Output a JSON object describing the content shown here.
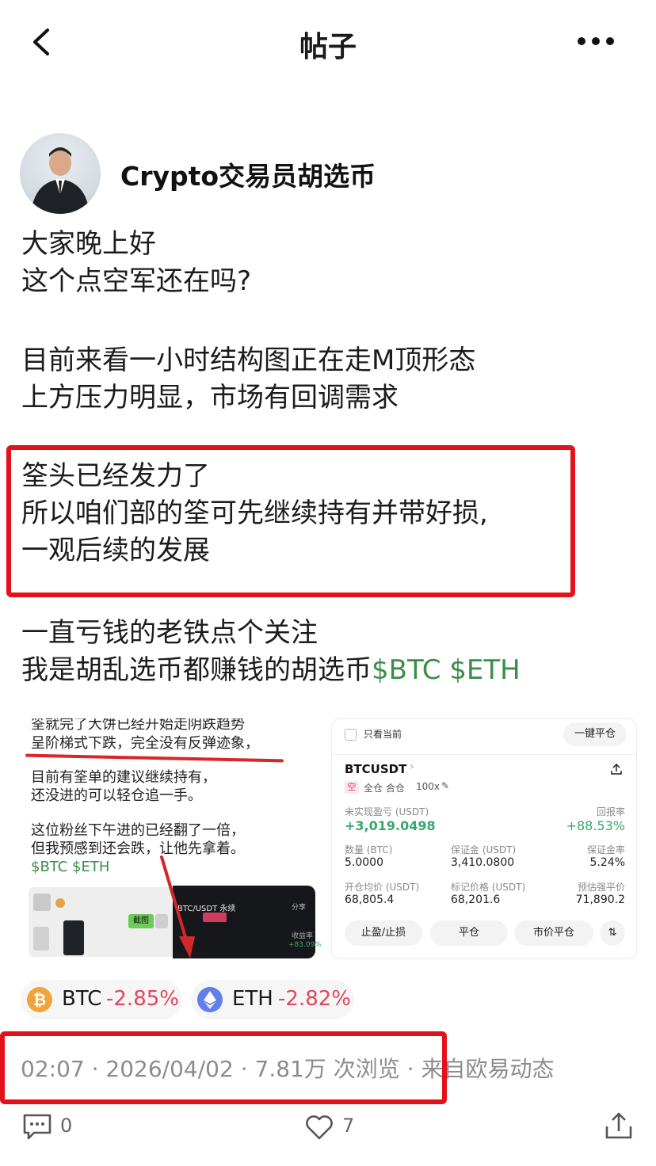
{
  "header": {
    "title": "帖子"
  },
  "author": {
    "name": "Crypto交易员胡选币"
  },
  "post": {
    "lines_1": [
      "大家晚上好",
      "这个点空军还在吗?"
    ],
    "lines_2": [
      "目前来看一小时结构图正在走M顶形态",
      "上方压力明显，市场有回调需求"
    ],
    "lines_3": [
      "筌头已经发力了",
      "所以咱们部的筌可先继续持有并带好损,",
      "一观后续的发展"
    ],
    "lines_4": [
      "一直亏钱的老铁点个关注",
      "我是胡乱选币都赚钱的胡选币"
    ],
    "tag_btc": "$BTC",
    "tag_eth": "$ETH"
  },
  "image_left": {
    "lines": [
      "筌就完了大饼已经开始走阴跌趋势",
      "呈阶梯式下跌，完全没有反弹迹象，",
      "目前有筌单的建议继续持有，",
      "还没进的可以轻仓追一手。",
      "这位粉丝下午进的已经翻了一倍，",
      "但我预感到还会跌，让他先拿着。"
    ],
    "tags": "$BTC $ETH",
    "mini_title": "BTC/USDT 永续",
    "mini_share": "分享",
    "mini_profit": "收益率",
    "mini_pct": "+83.09%",
    "mini_btn": "截图"
  },
  "image_right": {
    "only_current": "只看当前",
    "close_all": "一键平仓",
    "pair": "BTCUSDT",
    "side": "空",
    "mode": "全仓 合仓",
    "leverage": "100x",
    "upnl_label": "未实现盈亏 (USDT)",
    "upnl_value": "+3,019.0498",
    "roe_label": "回报率",
    "roe_value": "+88.53%",
    "qty_label": "数量 (BTC)",
    "qty_value": "5.0000",
    "margin_label": "保证金 (USDT)",
    "margin_value": "3,410.0800",
    "margin_rate_label": "保证金率",
    "margin_rate_value": "5.24%",
    "entry_label": "开仓均价 (USDT)",
    "entry_value": "68,805.4",
    "mark_label": "标记价格 (USDT)",
    "mark_value": "68,201.6",
    "liq_label": "预估强平价",
    "liq_value": "71,890.2",
    "btn_tpsl": "止盈/止损",
    "btn_close": "平仓",
    "btn_market_close": "市价平仓"
  },
  "coins": [
    {
      "symbol": "BTC",
      "change": "-2.85%",
      "color": "#f2a33a"
    },
    {
      "symbol": "ETH",
      "change": "-2.82%",
      "color": "#627eea"
    }
  ],
  "meta": {
    "time": "02:07",
    "date": "2026/04/02",
    "views": "7.81万 次浏览",
    "source": "来自欧易动态"
  },
  "actions": {
    "comments": "0",
    "likes": "7"
  }
}
